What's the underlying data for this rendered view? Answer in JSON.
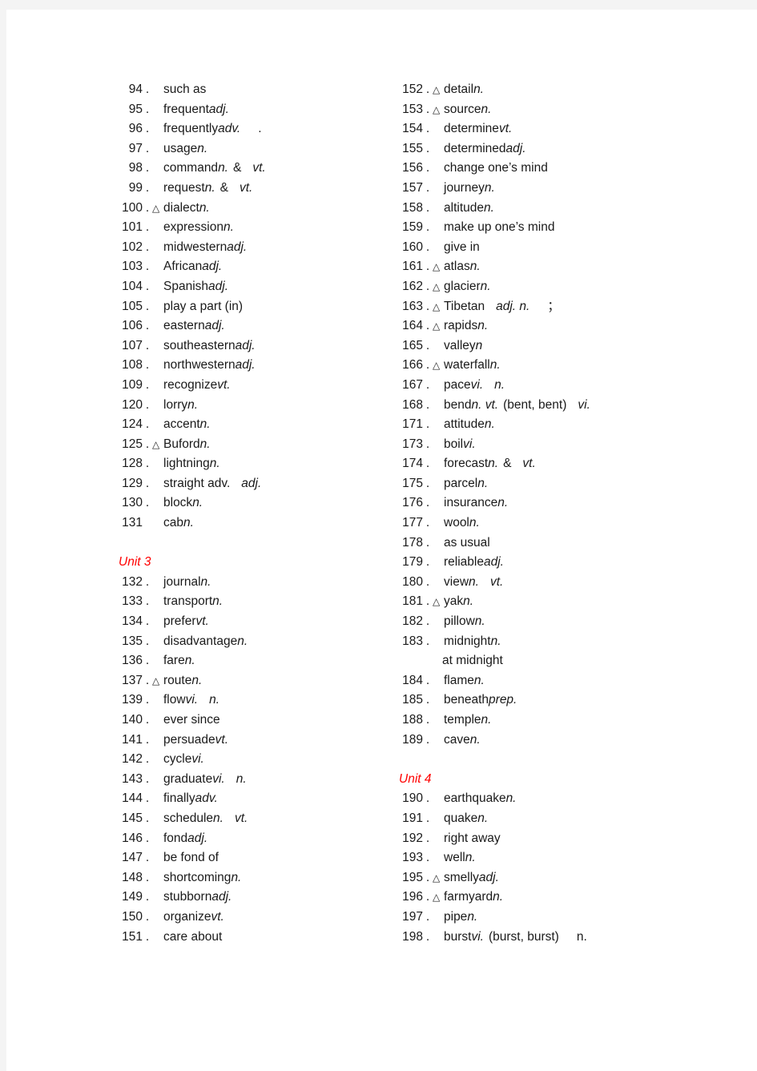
{
  "page": {
    "background_color": "#ffffff",
    "surround_color": "#f4f4f4",
    "text_color": "#1a1a1a",
    "unit_heading_color": "#ff0000",
    "marker_glyph": "△"
  },
  "left_column": [
    {
      "type": "entry",
      "num": "94",
      "sep": ".",
      "marker": "",
      "word": "such as",
      "pos": "",
      "pos2": "",
      "extra": "",
      "tail": ""
    },
    {
      "type": "entry",
      "num": "95",
      "sep": ".",
      "marker": "",
      "word": "frequent",
      "pos": "adj.",
      "pos2": "",
      "extra": "",
      "tail": ""
    },
    {
      "type": "entry",
      "num": "96",
      "sep": ".",
      "marker": "",
      "word": "frequently ",
      "pos": "adv.",
      "pos2": "",
      "extra": "",
      "tail": "."
    },
    {
      "type": "entry",
      "num": "97",
      "sep": ".",
      "marker": "",
      "word": "usage",
      "pos": "n.",
      "pos2": "",
      "extra": "",
      "tail": ""
    },
    {
      "type": "entry",
      "num": "98",
      "sep": ".",
      "marker": "",
      "word": "command",
      "pos": "n.",
      "pos2": "vt.",
      "extra": "&",
      "tail": ""
    },
    {
      "type": "entry",
      "num": "99",
      "sep": ".",
      "marker": "",
      "word": "request",
      "pos": "n.",
      "pos2": "vt.",
      "extra": "&",
      "tail": ""
    },
    {
      "type": "entry",
      "num": "100",
      "sep": ".",
      "marker": "△",
      "word": "dialect ",
      "pos": "n.",
      "pos2": "",
      "extra": "",
      "tail": ""
    },
    {
      "type": "entry",
      "num": "101",
      "sep": ".",
      "marker": "",
      "word": "expression",
      "pos": "n.",
      "pos2": "",
      "extra": "",
      "tail": ""
    },
    {
      "type": "entry",
      "num": "102",
      "sep": ".",
      "marker": "",
      "word": "midwestern",
      "pos": "adj.",
      "pos2": "",
      "extra": "",
      "tail": ""
    },
    {
      "type": "entry",
      "num": "103",
      "sep": ".",
      "marker": "",
      "word": "African ",
      "pos": "adj.",
      "pos2": "",
      "extra": "",
      "tail": ""
    },
    {
      "type": "entry",
      "num": "104",
      "sep": ".",
      "marker": "",
      "word": "Spanish",
      "pos": "adj.",
      "pos2": "",
      "extra": "",
      "tail": ""
    },
    {
      "type": "entry",
      "num": "105",
      "sep": ".",
      "marker": "",
      "word": "play a part (in)",
      "pos": "",
      "pos2": "",
      "extra": "",
      "tail": ""
    },
    {
      "type": "entry",
      "num": "106",
      "sep": ".",
      "marker": "",
      "word": "eastern",
      "pos": "adj.",
      "pos2": "",
      "extra": "",
      "tail": ""
    },
    {
      "type": "entry",
      "num": "107",
      "sep": ".",
      "marker": "",
      "word": "southeastern",
      "pos": "adj.",
      "pos2": "",
      "extra": "",
      "tail": ""
    },
    {
      "type": "entry",
      "num": "108",
      "sep": ".",
      "marker": "",
      "word": "northwestern",
      "pos": "adj.",
      "pos2": "",
      "extra": "",
      "tail": ""
    },
    {
      "type": "entry",
      "num": "109",
      "sep": ".",
      "marker": "",
      "word": "recognize",
      "pos": "vt.",
      "pos2": "",
      "extra": "",
      "tail": ""
    },
    {
      "type": "entry",
      "num": "120",
      "sep": ".",
      "marker": "",
      "word": "lorry ",
      "pos": "n.",
      "pos2": "",
      "extra": "",
      "tail": ""
    },
    {
      "type": "entry",
      "num": "124",
      "sep": ".",
      "marker": "",
      "word": "accent",
      "pos": "n.",
      "pos2": "",
      "extra": "",
      "tail": ""
    },
    {
      "type": "entry",
      "num": "125",
      "sep": ".",
      "marker": "△",
      "word": "Buford ",
      "pos": "n.",
      "pos2": "",
      "extra": "",
      "tail": ""
    },
    {
      "type": "entry",
      "num": "128",
      "sep": ".",
      "marker": "",
      "word": "lightning ",
      "pos": "n.",
      "pos2": "",
      "extra": "",
      "tail": ""
    },
    {
      "type": "entry",
      "num": "129",
      "sep": ".",
      "marker": "",
      "word": "straight adv.",
      "pos": "",
      "pos2": "adj.",
      "extra": "",
      "tail": ""
    },
    {
      "type": "entry",
      "num": "130",
      "sep": ".",
      "marker": "",
      "word": "block ",
      "pos": "n.",
      "pos2": "",
      "extra": "",
      "tail": ""
    },
    {
      "type": "entry",
      "num": "131",
      "sep": "",
      "marker": "",
      "word": "cab ",
      "pos": "n.",
      "pos2": "",
      "extra": "",
      "tail": ""
    },
    {
      "type": "blank"
    },
    {
      "type": "unit",
      "label": "Unit 3"
    },
    {
      "type": "entry",
      "num": "132",
      "sep": ".",
      "marker": "",
      "word": "journal ",
      "pos": "n.",
      "pos2": "",
      "extra": "",
      "tail": ""
    },
    {
      "type": "entry",
      "num": "133",
      "sep": ".",
      "marker": "",
      "word": "transport",
      "pos": "n.",
      "pos2": "",
      "extra": "",
      "tail": ""
    },
    {
      "type": "entry",
      "num": "134",
      "sep": ".",
      "marker": "",
      "word": "prefer ",
      "pos": "vt.",
      "pos2": "",
      "extra": "",
      "tail": ""
    },
    {
      "type": "entry",
      "num": "135",
      "sep": ".",
      "marker": "",
      "word": "disadvantage",
      "pos": "n.",
      "pos2": "",
      "extra": "",
      "tail": ""
    },
    {
      "type": "entry",
      "num": "136",
      "sep": ".",
      "marker": "",
      "word": "fare ",
      "pos": "n.",
      "pos2": "",
      "extra": "",
      "tail": ""
    },
    {
      "type": "entry",
      "num": "137",
      "sep": ".",
      "marker": "△",
      "word": "route ",
      "pos": "n.",
      "pos2": "",
      "extra": "",
      "tail": ""
    },
    {
      "type": "entry",
      "num": "139",
      "sep": ".",
      "marker": "",
      "word": "flow ",
      "pos": "vi.",
      "pos2": "n.",
      "extra": "",
      "tail": ""
    },
    {
      "type": "entry",
      "num": "140",
      "sep": ".",
      "marker": "",
      "word": "ever since",
      "pos": "",
      "pos2": "",
      "extra": "",
      "tail": ""
    },
    {
      "type": "entry",
      "num": "141",
      "sep": ".",
      "marker": "",
      "word": "persuade",
      "pos": "vt.",
      "pos2": "",
      "extra": "",
      "tail": ""
    },
    {
      "type": "entry",
      "num": "142",
      "sep": ".",
      "marker": "",
      "word": "cycle ",
      "pos": "vi.",
      "pos2": "",
      "extra": "",
      "tail": ""
    },
    {
      "type": "entry",
      "num": "143",
      "sep": ".",
      "marker": "",
      "word": "graduate",
      "pos": "vi.",
      "pos2": "n.",
      "extra": "",
      "tail": ""
    },
    {
      "type": "entry",
      "num": "144",
      "sep": ".",
      "marker": "",
      "word": "finally ",
      "pos": "adv.",
      "pos2": "",
      "extra": "",
      "tail": ""
    },
    {
      "type": "entry",
      "num": "145",
      "sep": ".",
      "marker": "",
      "word": "schedule",
      "pos": "n.",
      "pos2": "vt.",
      "extra": "",
      "tail": ""
    },
    {
      "type": "entry",
      "num": "146",
      "sep": ".",
      "marker": "",
      "word": "fond ",
      "pos": "adj.",
      "pos2": "",
      "extra": "",
      "tail": ""
    },
    {
      "type": "entry",
      "num": "147",
      "sep": ".",
      "marker": "",
      "word": "be fond of",
      "pos": "",
      "pos2": "",
      "extra": "",
      "tail": ""
    },
    {
      "type": "entry",
      "num": "148",
      "sep": ".",
      "marker": "",
      "word": "shortcoming",
      "pos": "n.",
      "pos2": "",
      "extra": "",
      "tail": ""
    },
    {
      "type": "entry",
      "num": "149",
      "sep": ".",
      "marker": "",
      "word": "stubborn",
      "pos": "adj.",
      "pos2": "",
      "extra": "",
      "tail": ""
    },
    {
      "type": "entry",
      "num": "150",
      "sep": ".",
      "marker": "",
      "word": "organize",
      "pos": "vt.",
      "pos2": "",
      "extra": "",
      "tail": ""
    },
    {
      "type": "entry",
      "num": "151",
      "sep": ".",
      "marker": "",
      "word": "care about",
      "pos": "",
      "pos2": "",
      "extra": "",
      "tail": ""
    }
  ],
  "right_column": [
    {
      "type": "entry",
      "num": "152",
      "sep": ".",
      "marker": "△",
      "word": "detail ",
      "pos": "n.",
      "pos2": "",
      "extra": "",
      "tail": ""
    },
    {
      "type": "entry",
      "num": "153",
      "sep": ".",
      "marker": "△",
      "word": "source ",
      "pos": "n.",
      "pos2": "",
      "extra": "",
      "tail": ""
    },
    {
      "type": "entry",
      "num": "154",
      "sep": ".",
      "marker": "",
      "word": "determine",
      "pos": "vt.",
      "pos2": "",
      "extra": "",
      "tail": ""
    },
    {
      "type": "entry",
      "num": "155",
      "sep": ".",
      "marker": "",
      "word": "determined",
      "pos": "adj.",
      "pos2": "",
      "extra": "",
      "tail": ""
    },
    {
      "type": "entry",
      "num": "156",
      "sep": ".",
      "marker": "",
      "word": "change one’s mind",
      "pos": "",
      "pos2": "",
      "extra": "",
      "tail": ""
    },
    {
      "type": "entry",
      "num": "157",
      "sep": ".",
      "marker": "",
      "word": "journey ",
      "pos": "n.",
      "pos2": "",
      "extra": "",
      "tail": ""
    },
    {
      "type": "entry",
      "num": "158",
      "sep": ".",
      "marker": "",
      "word": "altitude ",
      "pos": "n.",
      "pos2": "",
      "extra": "",
      "tail": ""
    },
    {
      "type": "entry",
      "num": "159",
      "sep": ".",
      "marker": "",
      "word": "make up one’s mind",
      "pos": "",
      "pos2": "",
      "extra": "",
      "tail": ""
    },
    {
      "type": "entry",
      "num": "160",
      "sep": ".",
      "marker": "",
      "word": "give in",
      "pos": "",
      "pos2": "",
      "extra": "",
      "tail": ""
    },
    {
      "type": "entry",
      "num": "161",
      "sep": ".",
      "marker": "△",
      "word": "atlas ",
      "pos": "n.",
      "pos2": "",
      "extra": "",
      "tail": ""
    },
    {
      "type": "entry",
      "num": "162",
      "sep": ".",
      "marker": "△",
      "word": "glacier ",
      "pos": "n.",
      "pos2": "",
      "extra": "",
      "tail": ""
    },
    {
      "type": "entry",
      "num": "163",
      "sep": ".",
      "marker": "△",
      "word": "Tibetan",
      "pos": "",
      "pos2": "adj. n.",
      "extra": "",
      "tail": "；"
    },
    {
      "type": "entry",
      "num": "164",
      "sep": ".",
      "marker": "△",
      "word": "rapids ",
      "pos": "n.",
      "pos2": "",
      "extra": "",
      "tail": ""
    },
    {
      "type": "entry",
      "num": "165",
      "sep": ".",
      "marker": "",
      "word": "valley ",
      "pos": "n",
      "pos2": "",
      "extra": "",
      "tail": ""
    },
    {
      "type": "entry",
      "num": "166",
      "sep": ".",
      "marker": "△",
      "word": "waterfall ",
      "pos": "n.",
      "pos2": "",
      "extra": "",
      "tail": ""
    },
    {
      "type": "entry",
      "num": "167",
      "sep": ".",
      "marker": "",
      "word": "pace",
      "pos": "vi.",
      "pos2": "n.",
      "extra": "",
      "tail": ""
    },
    {
      "type": "entry",
      "num": "168",
      "sep": ".",
      "marker": "",
      "word": "bend",
      "pos": "n. vt.",
      "pos2": "vi.",
      "extra": "(bent, bent)",
      "tail": ""
    },
    {
      "type": "entry",
      "num": "171",
      "sep": ".",
      "marker": "",
      "word": "attitude",
      "pos": "n.",
      "pos2": "",
      "extra": "",
      "tail": ""
    },
    {
      "type": "entry",
      "num": "173",
      "sep": ".",
      "marker": "",
      "word": "boil ",
      "pos": "vi.",
      "pos2": "",
      "extra": "",
      "tail": ""
    },
    {
      "type": "entry",
      "num": "174",
      "sep": ".",
      "marker": "",
      "word": "forecast",
      "pos": "n.",
      "pos2": "vt.",
      "extra": "&",
      "tail": ""
    },
    {
      "type": "entry",
      "num": "175",
      "sep": ".",
      "marker": "",
      "word": "parcel",
      "pos": "n.",
      "pos2": "",
      "extra": "",
      "tail": ""
    },
    {
      "type": "entry",
      "num": "176",
      "sep": ".",
      "marker": "",
      "word": "insurance",
      "pos": "n.",
      "pos2": "",
      "extra": "",
      "tail": ""
    },
    {
      "type": "entry",
      "num": "177",
      "sep": ".",
      "marker": "",
      "word": "wool ",
      "pos": "n.",
      "pos2": "",
      "extra": "",
      "tail": ""
    },
    {
      "type": "entry",
      "num": "178",
      "sep": ".",
      "marker": "",
      "word": "as usual",
      "pos": "",
      "pos2": "",
      "extra": "",
      "tail": ""
    },
    {
      "type": "entry",
      "num": "179",
      "sep": ".",
      "marker": "",
      "word": "reliable ",
      "pos": "adj.",
      "pos2": "",
      "extra": "",
      "tail": ""
    },
    {
      "type": "entry",
      "num": "180",
      "sep": ".",
      "marker": "",
      "word": "view ",
      "pos": "n.",
      "pos2": "vt.",
      "extra": "",
      "tail": ""
    },
    {
      "type": "entry",
      "num": "181",
      "sep": ".",
      "marker": "△",
      "word": "yak ",
      "pos": "n.",
      "pos2": "",
      "extra": "",
      "tail": ""
    },
    {
      "type": "entry",
      "num": "182",
      "sep": ".",
      "marker": "",
      "word": "pillow ",
      "pos": "n.",
      "pos2": "",
      "extra": "",
      "tail": ""
    },
    {
      "type": "entry",
      "num": "183",
      "sep": ".",
      "marker": "",
      "word": "midnight ",
      "pos": "n.",
      "pos2": "",
      "extra": "",
      "tail": ""
    },
    {
      "type": "sub",
      "label": "at midnight"
    },
    {
      "type": "entry",
      "num": "184",
      "sep": ".",
      "marker": "",
      "word": "flame ",
      "pos": "n.",
      "pos2": "",
      "extra": "",
      "tail": ""
    },
    {
      "type": "entry",
      "num": "185",
      "sep": ".",
      "marker": "",
      "word": "beneath",
      "pos": "prep.",
      "pos2": "",
      "extra": "",
      "tail": ""
    },
    {
      "type": "entry",
      "num": "188",
      "sep": ".",
      "marker": "",
      "word": "temple",
      "pos": "n.",
      "pos2": "",
      "extra": "",
      "tail": ""
    },
    {
      "type": "entry",
      "num": "189",
      "sep": ".",
      "marker": "",
      "word": "cave",
      "pos": "n.",
      "pos2": "",
      "extra": "",
      "tail": ""
    },
    {
      "type": "blank"
    },
    {
      "type": "unit",
      "label": "Unit 4"
    },
    {
      "type": "entry",
      "num": "190",
      "sep": ".",
      "marker": "",
      "word": "earthquake",
      "pos": "n.",
      "pos2": "",
      "extra": "",
      "tail": ""
    },
    {
      "type": "entry",
      "num": "191",
      "sep": ".",
      "marker": "",
      "word": "quake",
      "pos": "n.",
      "pos2": "",
      "extra": "",
      "tail": ""
    },
    {
      "type": "entry",
      "num": "192",
      "sep": ".",
      "marker": "",
      "word": "right away",
      "pos": "",
      "pos2": "",
      "extra": "",
      "tail": ""
    },
    {
      "type": "entry",
      "num": "193",
      "sep": ".",
      "marker": "",
      "word": "well ",
      "pos": "n.",
      "pos2": "",
      "extra": "",
      "tail": ""
    },
    {
      "type": "entry",
      "num": "195",
      "sep": ".",
      "marker": "△",
      "word": "smelly ",
      "pos": "adj.",
      "pos2": "",
      "extra": "",
      "tail": ""
    },
    {
      "type": "entry",
      "num": "196",
      "sep": ".",
      "marker": "△",
      "word": "farmyard ",
      "pos": "n.",
      "pos2": "",
      "extra": "",
      "tail": ""
    },
    {
      "type": "entry",
      "num": "197",
      "sep": ".",
      "marker": "",
      "word": "pipe ",
      "pos": "n.",
      "pos2": "",
      "extra": "",
      "tail": ""
    },
    {
      "type": "entry",
      "num": "198",
      "sep": ".",
      "marker": "",
      "word": "burst",
      "pos": "vi.",
      "pos2": "",
      "extra": "(burst, burst)",
      "tail": "n."
    }
  ]
}
